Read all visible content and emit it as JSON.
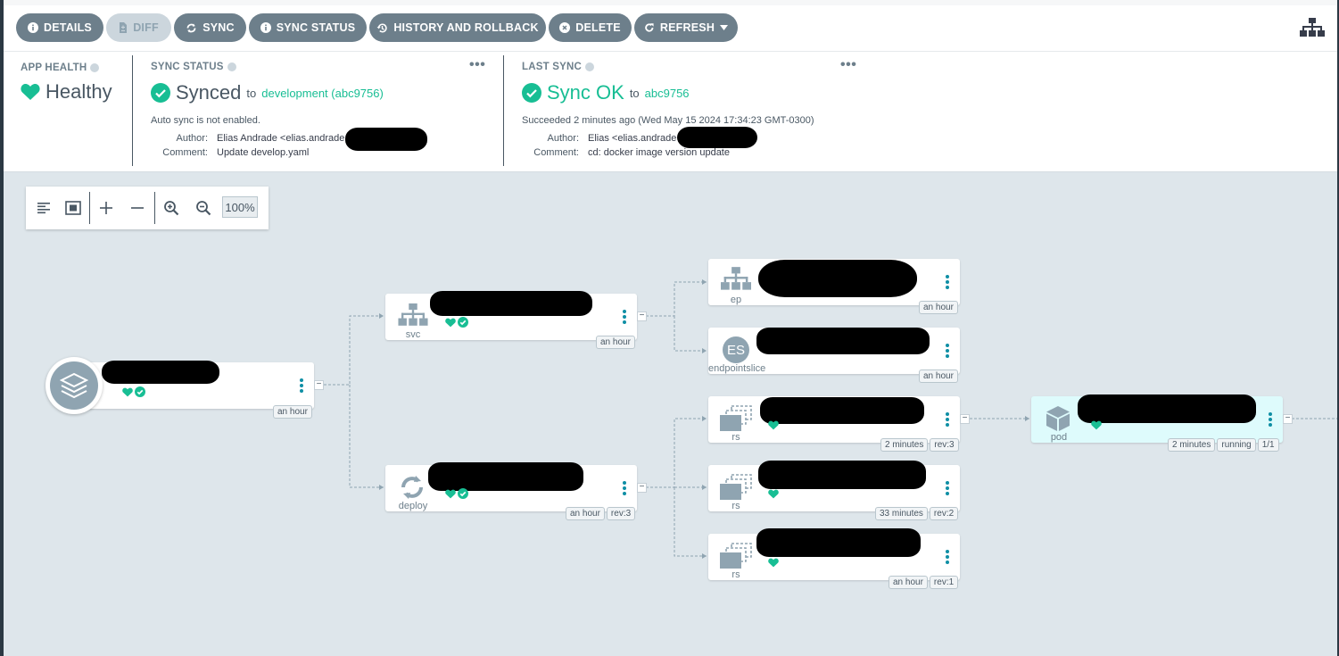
{
  "toolbar": {
    "details": "DETAILS",
    "diff": "DIFF",
    "sync": "SYNC",
    "sync_status": "SYNC STATUS",
    "history": "HISTORY AND ROLLBACK",
    "delete": "DELETE",
    "refresh": "REFRESH"
  },
  "app_health": {
    "label": "APP HEALTH",
    "value": "Healthy"
  },
  "sync_status": {
    "label": "SYNC STATUS",
    "value": "Synced",
    "to": "to",
    "target": "development (abc9756)",
    "auto_sync": "Auto sync is not enabled.",
    "author_key": "Author:",
    "author_val": "Elias Andrade <elias.andrade",
    "comment_key": "Comment:",
    "comment_val": "Update develop.yaml",
    "more": "•••"
  },
  "last_sync": {
    "label": "LAST SYNC",
    "value": "Sync OK",
    "to": "to",
    "target": "abc9756",
    "succeeded": "Succeeded 2 minutes ago (Wed May 15 2024 17:34:23 GMT-0300)",
    "author_key": "Author:",
    "author_val": "Elias <elias.andrade",
    "comment_key": "Comment:",
    "comment_val": "cd: docker image version update",
    "more": "•••"
  },
  "zoom": {
    "level": "100%"
  },
  "nodes": {
    "app": {
      "age": "an hour"
    },
    "svc": {
      "kind": "svc",
      "age": "an hour"
    },
    "deploy": {
      "kind": "deploy",
      "age": "an hour",
      "rev": "rev:3"
    },
    "ep": {
      "kind": "ep",
      "age": "an hour"
    },
    "endpointslice": {
      "kind": "endpointslice",
      "badge": "ES",
      "age": "an hour"
    },
    "rs1": {
      "kind": "rs",
      "age": "2 minutes",
      "rev": "rev:3"
    },
    "rs2": {
      "kind": "rs",
      "age": "33 minutes",
      "rev": "rev:2"
    },
    "rs3": {
      "kind": "rs",
      "age": "an hour",
      "rev": "rev:1"
    },
    "pod": {
      "kind": "pod",
      "age": "2 minutes",
      "state": "running",
      "ready": "1/1"
    }
  },
  "colors": {
    "healthy": "#18be94",
    "button": "#6d7f8b",
    "menu_dots": "#0f8fa5",
    "pod_bg": "#defbfc",
    "canvas": "#dee6eb"
  }
}
